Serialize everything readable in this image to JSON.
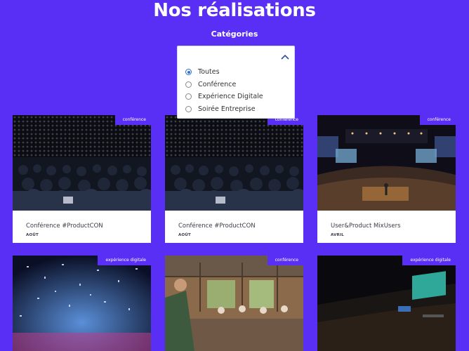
{
  "page": {
    "title": "Nos réalisations"
  },
  "filter": {
    "label": "Catégories",
    "options": [
      {
        "label": "Toutes",
        "selected": true
      },
      {
        "label": "Conférence",
        "selected": false
      },
      {
        "label": "Expérience Digitale",
        "selected": false
      },
      {
        "label": "Soirée Entreprise",
        "selected": false
      }
    ],
    "icon": "chevron-up-icon"
  },
  "cards": [
    {
      "tag": "conférence",
      "title": "Conférence #ProductCON",
      "month": "AOÛT"
    },
    {
      "tag": "conférence",
      "title": "Conférence #ProductCON",
      "month": "AOÛT"
    },
    {
      "tag": "conférence",
      "title": "User&Product MixUsers",
      "month": "AVRIL"
    },
    {
      "tag": "expérience digitale",
      "title": "",
      "month": ""
    },
    {
      "tag": "conférence",
      "title": "",
      "month": ""
    },
    {
      "tag": "expérience digitale",
      "title": "",
      "month": ""
    }
  ],
  "colors": {
    "background": "#5a2ff5",
    "accent": "#2b6fd6",
    "card": "#ffffff"
  }
}
